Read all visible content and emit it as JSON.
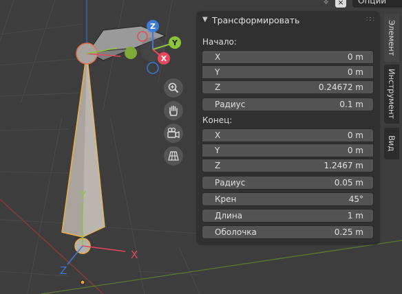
{
  "topbar": {
    "close_label": "×",
    "options_label": "Опции"
  },
  "panel": {
    "title": "Трансформировать",
    "head_section": {
      "label": "Начало:",
      "x": {
        "label": "X",
        "value": "0 m"
      },
      "y": {
        "label": "Y",
        "value": "0 m"
      },
      "z": {
        "label": "Z",
        "value": "0.24672 m"
      },
      "radius": {
        "label": "Радиус",
        "value": "0.1 m"
      }
    },
    "tail_section": {
      "label": "Конец:",
      "x": {
        "label": "X",
        "value": "0 m"
      },
      "y": {
        "label": "Y",
        "value": "0 m"
      },
      "z": {
        "label": "Z",
        "value": "1.2467 m"
      },
      "radius": {
        "label": "Радиус",
        "value": "0.05 m"
      }
    },
    "roll": {
      "label": "Крен",
      "value": "45°"
    },
    "length": {
      "label": "Длина",
      "value": "1 m"
    },
    "envelope": {
      "label": "Оболочка",
      "value": "0.25 m"
    }
  },
  "sidetabs": [
    "Элемент",
    "Инструмент",
    "Вид"
  ],
  "gizmo": {
    "z": "Z",
    "y": "Y",
    "x": "X"
  },
  "axes": {
    "y": "Y",
    "x": "X",
    "z": "Z"
  },
  "colors": {
    "bone_outline": "#f0b040",
    "axis_x": "#e8475d",
    "axis_y": "#8bc53a",
    "axis_z": "#3e7bd6"
  }
}
